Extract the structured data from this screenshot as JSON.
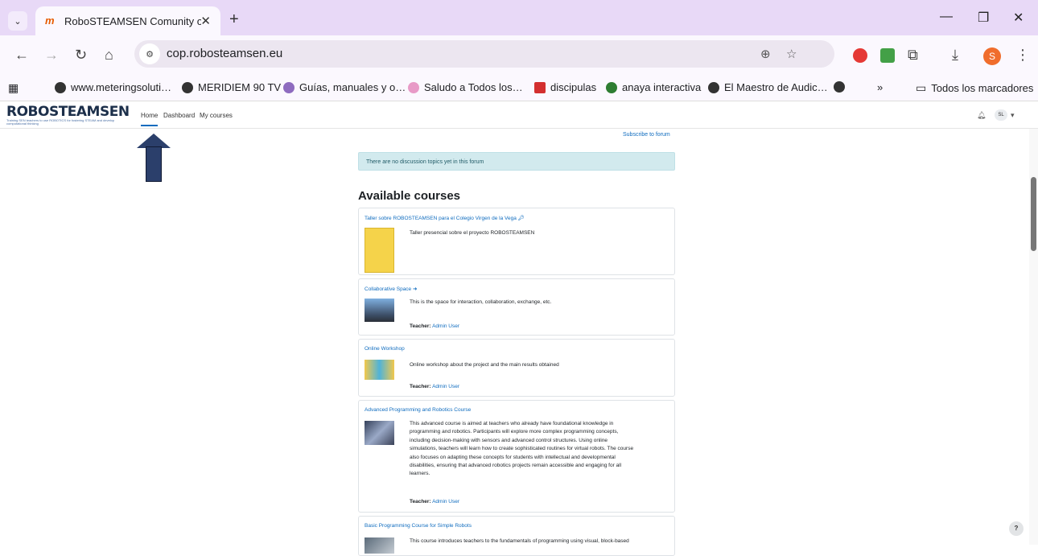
{
  "browser": {
    "tab_title": "RoboSTEAMSEN Comunity of P",
    "url": "cop.robosteamsen.eu",
    "bookmarks": [
      {
        "label": "www.meteringsoluti…"
      },
      {
        "label": "MERIDIEM 90 TV"
      },
      {
        "label": "Guías, manuales y o…"
      },
      {
        "label": "Saludo a Todos los…"
      },
      {
        "label": "discipulas"
      },
      {
        "label": "anaya interactiva"
      },
      {
        "label": "El Maestro de Audic…"
      }
    ],
    "all_bookmarks": "Todos los marcadores",
    "more": "»",
    "profile_initial": "S"
  },
  "site": {
    "logo": "ROBOSTEAMSEN",
    "logo_tagline": "Training SEN teachers to use ROBOTICS for fostering STEAM and develop computational thinking",
    "nav": [
      {
        "label": "Home",
        "active": true
      },
      {
        "label": "Dashboard"
      },
      {
        "label": "My courses"
      }
    ],
    "user_initials": "SL"
  },
  "forum": {
    "subscribe": "Subscribe to forum",
    "empty_notice": "There are no discussion topics yet in this forum"
  },
  "courses": {
    "heading": "Available courses",
    "items": [
      {
        "title": "Taller sobre ROBOSTEAMSEN para el Colegio Virgen de la Vega",
        "summary": "Taller presencial sobre el proyecto ROBOSTEAMSEN",
        "teacher_label": "",
        "teacher": ""
      },
      {
        "title": "Collaborative Space",
        "summary": "This is the space for interaction, collaboration, exchange, etc.",
        "teacher_label": "Teacher:",
        "teacher": "Admin User"
      },
      {
        "title": "Online Workshop",
        "summary": "Online workshop about the project and the main results obtained",
        "teacher_label": "Teacher:",
        "teacher": "Admin User"
      },
      {
        "title": "Advanced Programming and Robotics Course",
        "summary_lines": [
          "This advanced course is aimed at teachers who already have foundational knowledge in",
          "programming and robotics. Participants will explore more complex programming concepts,",
          "including decision-making with sensors and advanced control structures. Using online",
          "simulations, teachers will learn how to create sophisticated routines for virtual robots. The course",
          "also focuses on adapting these concepts for students with intellectual and developmental",
          "disabilities, ensuring that advanced robotics projects remain accessible and engaging for all",
          "learners."
        ],
        "teacher_label": "Teacher:",
        "teacher": "Admin User"
      },
      {
        "title": "Basic Programming Course for Simple Robots",
        "summary": "This course introduces teachers to the fundamentals of programming using visual, block-based"
      }
    ]
  },
  "help": "?"
}
